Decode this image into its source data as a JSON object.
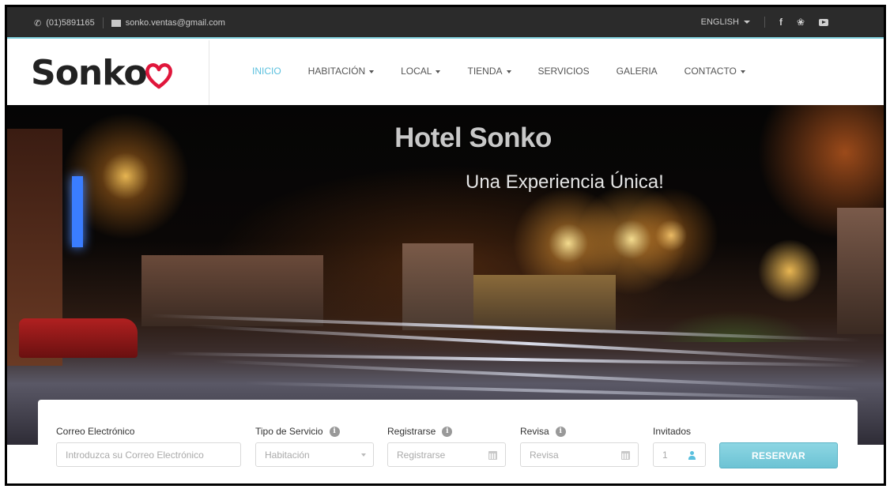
{
  "topbar": {
    "phone": "(01)5891165",
    "email": "sonko.ventas@gmail.com",
    "language": "ENGLISH",
    "social": [
      "f",
      "y"
    ]
  },
  "header": {
    "logo_text": "Sonko",
    "nav": [
      {
        "label": "INICIO",
        "active": true,
        "dropdown": false
      },
      {
        "label": "HABITACIÓN",
        "active": false,
        "dropdown": true
      },
      {
        "label": "LOCAL",
        "active": false,
        "dropdown": true
      },
      {
        "label": "TIENDA",
        "active": false,
        "dropdown": true
      },
      {
        "label": "SERVICIOS",
        "active": false,
        "dropdown": false
      },
      {
        "label": "GALERIA",
        "active": false,
        "dropdown": false
      },
      {
        "label": "CONTACTO",
        "active": false,
        "dropdown": true
      }
    ]
  },
  "hero": {
    "title": "Hotel Sonko",
    "subtitle": "Una Experiencia Única!"
  },
  "booking": {
    "email": {
      "label": "Correo Electrónico",
      "placeholder": "Introduzca su Correo Electrónico"
    },
    "service": {
      "label": "Tipo de Servicio",
      "placeholder": "Habitación"
    },
    "checkin": {
      "label": "Registrarse",
      "placeholder": "Registrarse"
    },
    "checkout": {
      "label": "Revisa",
      "placeholder": "Revisa"
    },
    "guests": {
      "label": "Invitados",
      "value": "1"
    },
    "submit_label": "RESERVAR"
  },
  "colors": {
    "accent": "#5bc0de",
    "topbar_bg": "#2b2b2b",
    "logo_heart": "#e0163b",
    "button": "#7ccddc"
  }
}
